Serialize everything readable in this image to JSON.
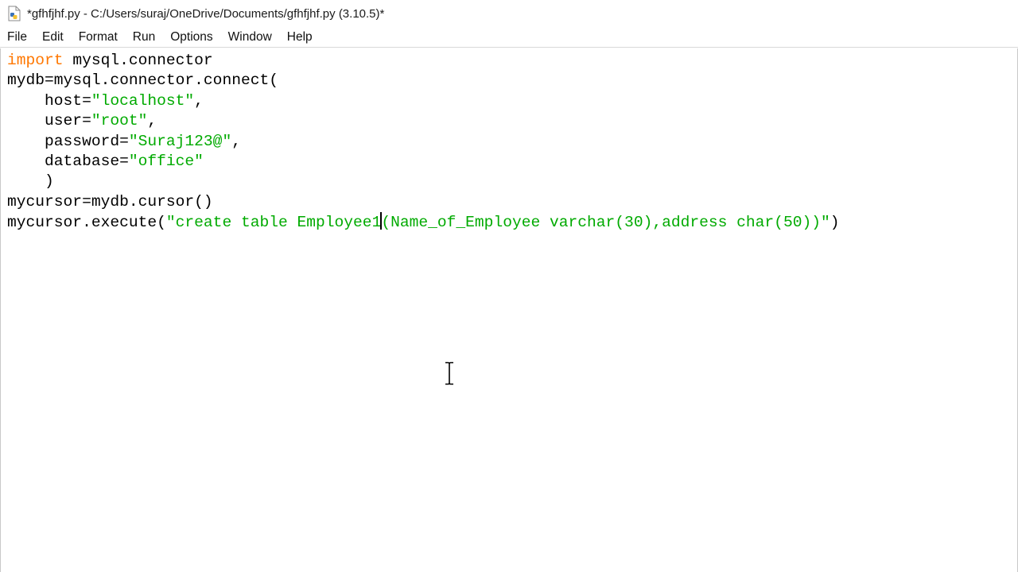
{
  "window": {
    "title": "*gfhfjhf.py - C:/Users/suraj/OneDrive/Documents/gfhfjhf.py (3.10.5)*",
    "icon": "python-file-icon"
  },
  "menubar": {
    "items": [
      {
        "label": "File"
      },
      {
        "label": "Edit"
      },
      {
        "label": "Format"
      },
      {
        "label": "Run"
      },
      {
        "label": "Options"
      },
      {
        "label": "Window"
      },
      {
        "label": "Help"
      }
    ]
  },
  "editor": {
    "lines": [
      {
        "segments": [
          {
            "kind": "kw",
            "text": "import"
          },
          {
            "kind": "plain",
            "text": " mysql.connector"
          }
        ]
      },
      {
        "segments": [
          {
            "kind": "plain",
            "text": "mydb=mysql.connector.connect("
          }
        ]
      },
      {
        "segments": [
          {
            "kind": "plain",
            "text": "    host="
          },
          {
            "kind": "str",
            "text": "\"localhost\""
          },
          {
            "kind": "plain",
            "text": ","
          }
        ]
      },
      {
        "segments": [
          {
            "kind": "plain",
            "text": "    user="
          },
          {
            "kind": "str",
            "text": "\"root\""
          },
          {
            "kind": "plain",
            "text": ","
          }
        ]
      },
      {
        "segments": [
          {
            "kind": "plain",
            "text": "    password="
          },
          {
            "kind": "str",
            "text": "\"Suraj123@\""
          },
          {
            "kind": "plain",
            "text": ","
          }
        ]
      },
      {
        "segments": [
          {
            "kind": "plain",
            "text": "    database="
          },
          {
            "kind": "str",
            "text": "\"office\""
          }
        ]
      },
      {
        "segments": [
          {
            "kind": "plain",
            "text": "    )"
          }
        ]
      },
      {
        "segments": [
          {
            "kind": "plain",
            "text": "mycursor=mydb.cursor()"
          }
        ]
      },
      {
        "segments": [
          {
            "kind": "plain",
            "text": "mycursor.execute("
          },
          {
            "kind": "str",
            "text": "\"create table Employee1"
          },
          {
            "kind": "caret",
            "text": ""
          },
          {
            "kind": "str",
            "text": "(Name_of_Employee varchar(30),address char(50))\""
          },
          {
            "kind": "plain",
            "text": ")"
          }
        ]
      }
    ]
  },
  "colors": {
    "keyword": "#ff7700",
    "string": "#00aa00",
    "text": "#000000",
    "background": "#ffffff"
  },
  "cursor": {
    "icon": "text-ibeam-cursor-icon"
  }
}
